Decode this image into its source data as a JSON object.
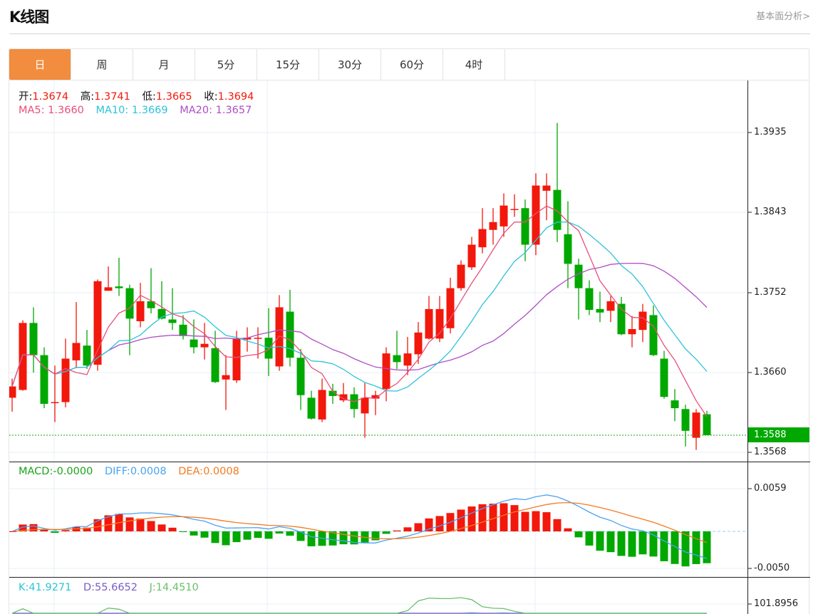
{
  "page": {
    "title": "K线图",
    "fundamental_link": "基本面分析>"
  },
  "tabs": [
    {
      "label": "日",
      "active": true
    },
    {
      "label": "周",
      "active": false
    },
    {
      "label": "月",
      "active": false
    },
    {
      "label": "5分",
      "active": false
    },
    {
      "label": "15分",
      "active": false
    },
    {
      "label": "30分",
      "active": false
    },
    {
      "label": "60分",
      "active": false
    },
    {
      "label": "4时",
      "active": false
    }
  ],
  "legend": {
    "open_label": "开:",
    "open": "1.3674",
    "high_label": "高:",
    "high": "1.3741",
    "low_label": "低:",
    "low": "1.3665",
    "close_label": "收:",
    "close": "1.3694",
    "ma5_label": "MA5:",
    "ma5": "1.3660",
    "ma10_label": "MA10:",
    "ma10": "1.3669",
    "ma20_label": "MA20:",
    "ma20": "1.3657"
  },
  "macd_legend": {
    "macd_label": "MACD:",
    "macd": "-0.0000",
    "diff_label": "DIFF:",
    "diff": "0.0008",
    "dea_label": "DEA:",
    "dea": "0.0008"
  },
  "kdj_legend": {
    "k_label": "K:",
    "k": "41.9271",
    "d_label": "D:",
    "d": "55.6652",
    "j_label": "J:",
    "j": "14.4510"
  },
  "colors": {
    "up": "#f2180c",
    "down": "#00a800",
    "ma5": "#e8507a",
    "ma10": "#2ec3d8",
    "ma20": "#ae4ec6",
    "diff": "#4aa3f0",
    "dea": "#f57a20",
    "k": "#2ec3d8",
    "d": "#7a5cc8",
    "j": "#6cbf6c",
    "active_tab": "#f28c3f"
  },
  "chart_data": {
    "type": "candlestick",
    "ohlc_fields": [
      "open",
      "high",
      "low",
      "close"
    ],
    "ohlc": [
      [
        1.3631,
        1.3653,
        1.3615,
        1.3644
      ],
      [
        1.364,
        1.372,
        1.3639,
        1.3717
      ],
      [
        1.3717,
        1.3735,
        1.366,
        1.368
      ],
      [
        1.368,
        1.3689,
        1.3619,
        1.3624
      ],
      [
        1.3625,
        1.3668,
        1.3603,
        1.3626
      ],
      [
        1.3626,
        1.3699,
        1.362,
        1.3676
      ],
      [
        1.3674,
        1.3741,
        1.3665,
        1.3694
      ],
      [
        1.3691,
        1.3709,
        1.3664,
        1.3668
      ],
      [
        1.3669,
        1.3767,
        1.3662,
        1.3765
      ],
      [
        1.3754,
        1.3782,
        1.3754,
        1.3758
      ],
      [
        1.3759,
        1.3792,
        1.3748,
        1.3757
      ],
      [
        1.3757,
        1.3761,
        1.368,
        1.3722
      ],
      [
        1.3719,
        1.3763,
        1.3712,
        1.3742
      ],
      [
        1.3742,
        1.378,
        1.3728,
        1.3734
      ],
      [
        1.3733,
        1.3765,
        1.3721,
        1.3722
      ],
      [
        1.3721,
        1.3757,
        1.3709,
        1.3717
      ],
      [
        1.3715,
        1.3726,
        1.3698,
        1.3702
      ],
      [
        1.3698,
        1.3721,
        1.3682,
        1.3689
      ],
      [
        1.3689,
        1.3717,
        1.3675,
        1.3693
      ],
      [
        1.3688,
        1.3708,
        1.3648,
        1.3649
      ],
      [
        1.3652,
        1.368,
        1.3617,
        1.3657
      ],
      [
        1.3651,
        1.3708,
        1.3648,
        1.3699
      ],
      [
        1.3698,
        1.3712,
        1.3684,
        1.37
      ],
      [
        1.3699,
        1.3712,
        1.3676,
        1.37
      ],
      [
        1.37,
        1.3734,
        1.3656,
        1.3676
      ],
      [
        1.3667,
        1.3749,
        1.3662,
        1.3735
      ],
      [
        1.373,
        1.3755,
        1.3667,
        1.3677
      ],
      [
        1.3677,
        1.3687,
        1.3617,
        1.3634
      ],
      [
        1.3631,
        1.3639,
        1.3606,
        1.3607
      ],
      [
        1.3606,
        1.3653,
        1.3603,
        1.364
      ],
      [
        1.3639,
        1.3647,
        1.3624,
        1.3633
      ],
      [
        1.3628,
        1.3648,
        1.3626,
        1.3635
      ],
      [
        1.3635,
        1.3643,
        1.3608,
        1.3618
      ],
      [
        1.3613,
        1.3648,
        1.3585,
        1.3631
      ],
      [
        1.363,
        1.3639,
        1.3611,
        1.3634
      ],
      [
        1.3641,
        1.3689,
        1.3627,
        1.3682
      ],
      [
        1.368,
        1.3708,
        1.3664,
        1.3672
      ],
      [
        1.3668,
        1.3701,
        1.3657,
        1.3682
      ],
      [
        1.3681,
        1.3718,
        1.367,
        1.3706
      ],
      [
        1.3699,
        1.3748,
        1.3698,
        1.3733
      ],
      [
        1.3699,
        1.3748,
        1.3695,
        1.3733
      ],
      [
        1.3711,
        1.3769,
        1.3705,
        1.3757
      ],
      [
        1.3757,
        1.3789,
        1.3754,
        1.3784
      ],
      [
        1.3781,
        1.3816,
        1.3778,
        1.3807
      ],
      [
        1.3804,
        1.3849,
        1.3797,
        1.3825
      ],
      [
        1.3824,
        1.3849,
        1.3807,
        1.3833
      ],
      [
        1.3828,
        1.3866,
        1.3816,
        1.3852
      ],
      [
        1.3847,
        1.3865,
        1.3839,
        1.3848
      ],
      [
        1.3849,
        1.3859,
        1.3788,
        1.3807
      ],
      [
        1.3807,
        1.3889,
        1.3795,
        1.3875
      ],
      [
        1.3869,
        1.3889,
        1.3835,
        1.3875
      ],
      [
        1.387,
        1.3947,
        1.381,
        1.3824
      ],
      [
        1.3819,
        1.3857,
        1.3757,
        1.3785
      ],
      [
        1.3784,
        1.3791,
        1.3721,
        1.3757
      ],
      [
        1.3757,
        1.3766,
        1.3726,
        1.3732
      ],
      [
        1.3733,
        1.3753,
        1.3718,
        1.3729
      ],
      [
        1.3731,
        1.3748,
        1.3718,
        1.3742
      ],
      [
        1.3739,
        1.3747,
        1.3703,
        1.3704
      ],
      [
        1.3704,
        1.3725,
        1.3689,
        1.371
      ],
      [
        1.3709,
        1.3739,
        1.3695,
        1.373
      ],
      [
        1.3726,
        1.3737,
        1.3679,
        1.368
      ],
      [
        1.3676,
        1.3685,
        1.363,
        1.3632
      ],
      [
        1.3628,
        1.3641,
        1.3604,
        1.3619
      ],
      [
        1.3618,
        1.3623,
        1.3575,
        1.3593
      ],
      [
        1.3585,
        1.3618,
        1.3571,
        1.3614
      ],
      [
        1.3612,
        1.3616,
        1.3588,
        1.3588
      ]
    ],
    "ma_periods": [
      5,
      10,
      20
    ],
    "price_axis": {
      "ticks": [
        "1.3935",
        "1.3843",
        "1.3752",
        "1.3660",
        "1.3568"
      ],
      "range": [
        1.3568,
        1.3935
      ]
    },
    "last_price": "1.3588",
    "macd_axis": {
      "ticks": [
        "0.0059",
        "-0.0050"
      ],
      "range": [
        -0.005,
        0.0059
      ]
    },
    "kdj_axis": {
      "ticks": [
        "101.8956"
      ]
    }
  }
}
